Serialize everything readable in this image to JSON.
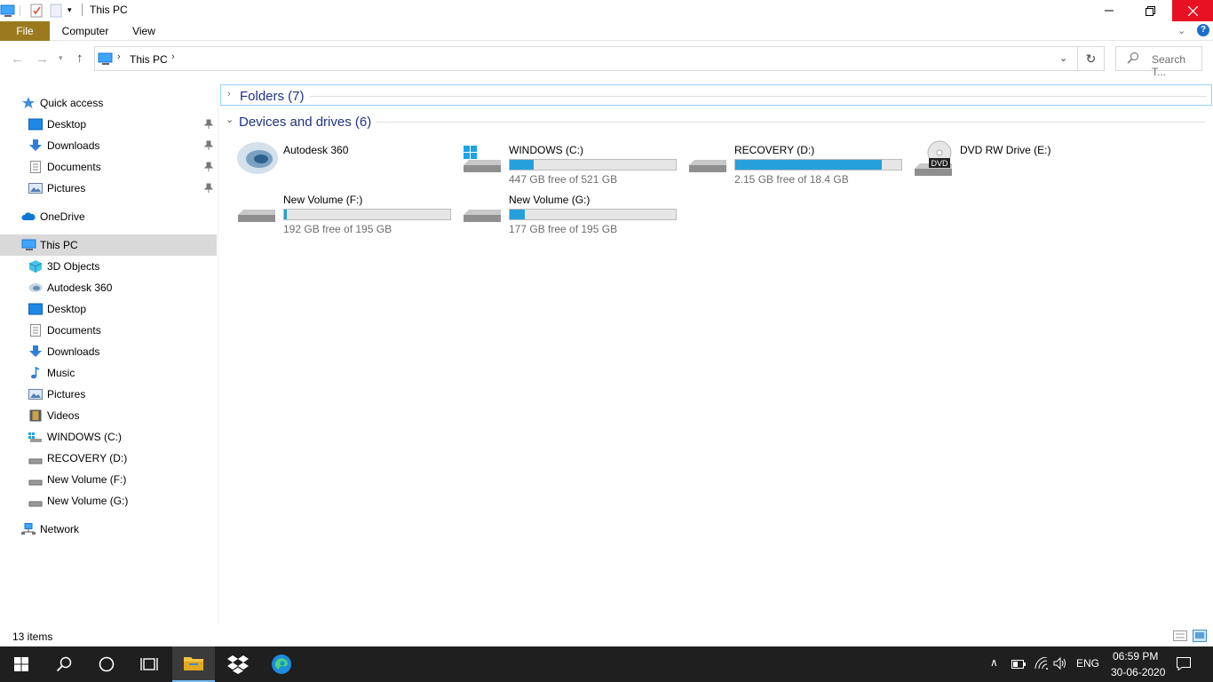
{
  "window": {
    "title": "This PC"
  },
  "ribbon": {
    "tabs": [
      "File",
      "Computer",
      "View"
    ]
  },
  "address": {
    "crumb": "This PC",
    "search_placeholder": "Search T..."
  },
  "nav": {
    "quick_access": "Quick access",
    "quick_items": [
      "Desktop",
      "Downloads",
      "Documents",
      "Pictures"
    ],
    "onedrive": "OneDrive",
    "this_pc": "This PC",
    "pc_items": [
      "3D Objects",
      "Autodesk 360",
      "Desktop",
      "Documents",
      "Downloads",
      "Music",
      "Pictures",
      "Videos",
      "WINDOWS (C:)",
      "RECOVERY (D:)",
      "New Volume (F:)",
      "New Volume (G:)"
    ],
    "network": "Network"
  },
  "groups": {
    "folders": "Folders (7)",
    "devices": "Devices and drives (6)"
  },
  "drives": [
    {
      "name": "Autodesk 360",
      "free": "",
      "used_fraction": null,
      "icon": "autodesk-icon"
    },
    {
      "name": "WINDOWS (C:)",
      "free": "447 GB free of 521 GB",
      "used_fraction": 0.142,
      "icon": "windows-drive-icon"
    },
    {
      "name": "RECOVERY (D:)",
      "free": "2.15 GB free of 18.4 GB",
      "used_fraction": 0.883,
      "icon": "hard-drive-icon"
    },
    {
      "name": "DVD RW Drive (E:)",
      "free": "",
      "used_fraction": null,
      "icon": "dvd-drive-icon"
    },
    {
      "name": "New Volume (F:)",
      "free": "192 GB free of 195 GB",
      "used_fraction": 0.015,
      "icon": "hard-drive-icon"
    },
    {
      "name": "New Volume (G:)",
      "free": "177 GB free of 195 GB",
      "used_fraction": 0.092,
      "icon": "hard-drive-icon"
    }
  ],
  "status": {
    "items": "13 items"
  },
  "taskbar": {
    "lang": "ENG",
    "time": "06:59 PM",
    "date": "30-06-2020"
  },
  "colors": {
    "accent": "#26a0da",
    "file_tab": "#9b7a1f",
    "close": "#e81123",
    "group_text": "#1e3287"
  }
}
